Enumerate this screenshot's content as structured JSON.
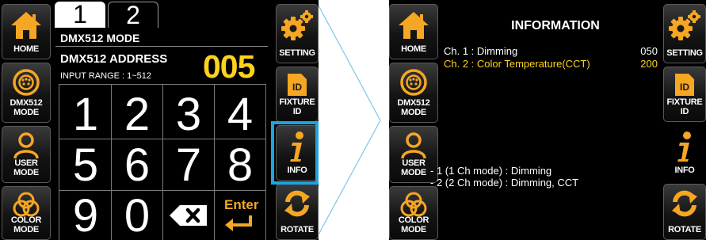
{
  "colors": {
    "accent_yellow": "#ffd21c",
    "highlight_blue": "#1fa3e0",
    "icon_orange": "#f5a623"
  },
  "left_screen": {
    "tabs": [
      "1",
      "2"
    ],
    "mode_title": "DMX512 MODE",
    "address_label": "DMX512 ADDRESS",
    "address_value": "005",
    "input_range": "INPUT RANGE : 1~512",
    "keypad": [
      "1",
      "2",
      "3",
      "4",
      "5",
      "6",
      "7",
      "8",
      "9",
      "0"
    ],
    "backspace_icon": "backspace-icon",
    "enter_label": "Enter",
    "left_menu": [
      {
        "label": "HOME",
        "icon": "home-icon"
      },
      {
        "label": "DMX512\nMODE",
        "icon": "dmx-connector-icon"
      },
      {
        "label": "USER\nMODE",
        "icon": "user-icon"
      },
      {
        "label": "COLOR\nMODE",
        "icon": "color-circles-icon"
      }
    ],
    "right_menu": [
      {
        "label": "SETTING",
        "icon": "gear-icon"
      },
      {
        "label": "FIXTURE\nID",
        "icon": "id-card-icon"
      },
      {
        "label": "INFO",
        "icon": "info-icon"
      },
      {
        "label": "ROTATE",
        "icon": "rotate-icon"
      }
    ]
  },
  "right_screen": {
    "title": "INFORMATION",
    "channels": [
      {
        "name": "Ch. 1 : Dimming",
        "value": "050"
      },
      {
        "name": "Ch. 2 : Color Temperature(CCT)",
        "value": "200"
      }
    ],
    "modes": [
      "- 1 (1 Ch mode) : Dimming",
      "- 2 (2 Ch mode) : Dimming, CCT"
    ],
    "left_menu": [
      {
        "label": "HOME",
        "icon": "home-icon"
      },
      {
        "label": "DMX512\nMODE",
        "icon": "dmx-connector-icon"
      },
      {
        "label": "USER\nMODE",
        "icon": "user-icon"
      },
      {
        "label": "COLOR\nMODE",
        "icon": "color-circles-icon"
      }
    ],
    "right_menu": [
      {
        "label": "SETTING",
        "icon": "gear-icon"
      },
      {
        "label": "FIXTURE\nID",
        "icon": "id-card-icon"
      },
      {
        "label": "INFO",
        "icon": "info-icon"
      },
      {
        "label": "ROTATE",
        "icon": "rotate-icon"
      }
    ]
  }
}
